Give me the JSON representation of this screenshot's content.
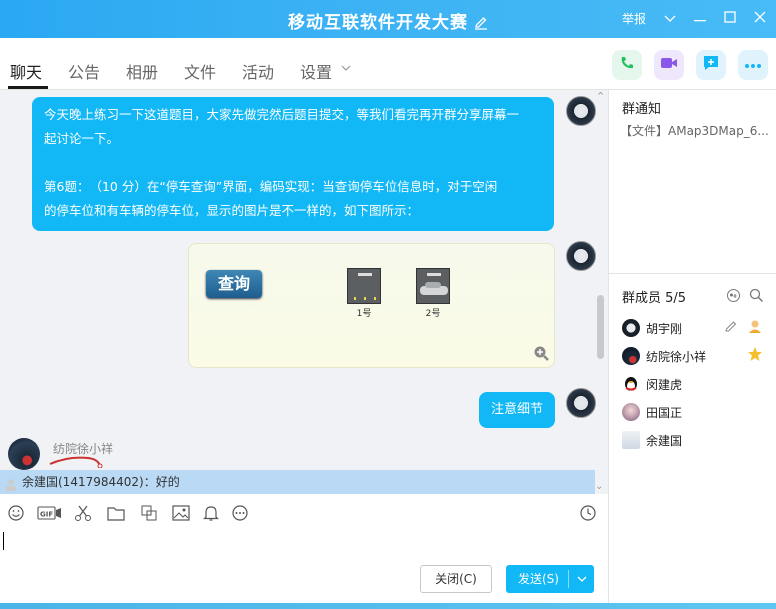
{
  "window": {
    "title": "移动互联软件开发大赛",
    "report_label": "举报"
  },
  "tabs": [
    {
      "label": "聊天"
    },
    {
      "label": "公告"
    },
    {
      "label": "相册"
    },
    {
      "label": "文件"
    },
    {
      "label": "活动"
    },
    {
      "label": "设置"
    }
  ],
  "chat": {
    "msg1": {
      "line1": "今天晚上练习一下这道题目，大家先做完然后题目提交，等我们看完再开群分享屏幕一",
      "line2": "起讨论一下。",
      "line3": "第6题：　（10 分）在“停车查询”界面，编码实现：当查询停车位信息时，对于空闲",
      "line4": "的停车位和有车辆的停车位，显示的图片是不一样的，如下图所示："
    },
    "image": {
      "query_label": "查询",
      "slot1_label": "1号",
      "slot2_label": "2号"
    },
    "msg3": "注意细节",
    "other_sender": "纺院徐小祥",
    "notice": "余建国(1417984402)：好的"
  },
  "composer": {
    "close_label": "关闭(C)",
    "send_label": "发送(S)"
  },
  "sidebar": {
    "notice_title": "群通知",
    "notice_text": "【文件】AMap3DMap_6...",
    "members_title": "群成员 5/5",
    "members": [
      {
        "name": "胡宇刚"
      },
      {
        "name": "纺院徐小祥"
      },
      {
        "name": "闵建虎"
      },
      {
        "name": "田国正"
      },
      {
        "name": "余建国"
      }
    ]
  },
  "colors": {
    "accent": "#12b7f5",
    "titlebar": "#3db3f4"
  }
}
